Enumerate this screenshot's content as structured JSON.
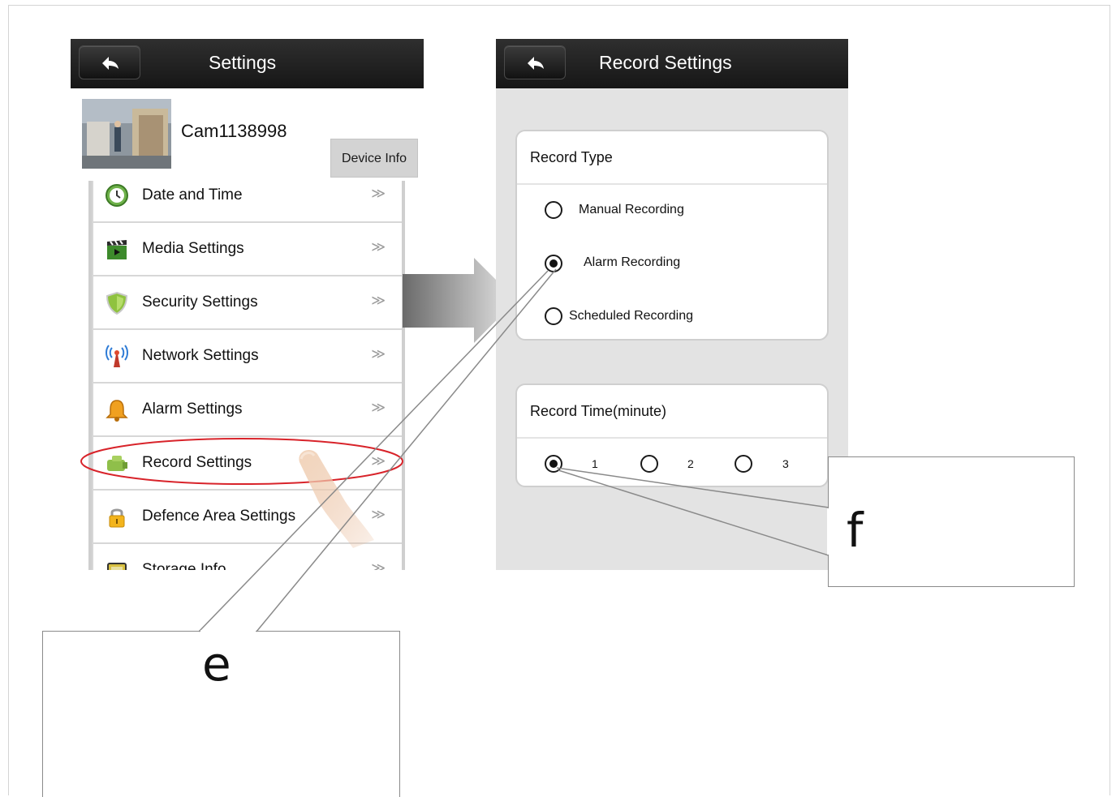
{
  "left_screen": {
    "title": "Settings",
    "device_name": "Cam1138998",
    "device_info_label": "Device Info",
    "menu_items": [
      {
        "label": "Date and Time",
        "icon": "clock-icon",
        "arrow": "≫"
      },
      {
        "label": "Media Settings",
        "icon": "clapperboard-icon",
        "arrow": "≫"
      },
      {
        "label": "Security Settings",
        "icon": "shield-icon",
        "arrow": "≫"
      },
      {
        "label": "Network Settings",
        "icon": "antenna-icon",
        "arrow": "≫"
      },
      {
        "label": "Alarm Settings",
        "icon": "bell-icon",
        "arrow": "≫"
      },
      {
        "label": "Record Settings",
        "icon": "camera-icon",
        "arrow": "≫"
      },
      {
        "label": "Defence Area Settings",
        "icon": "lock-icon",
        "arrow": "≫"
      },
      {
        "label": "Storage Info",
        "icon": "storage-icon",
        "arrow": "≫"
      }
    ],
    "highlighted_item": "Record Settings"
  },
  "right_screen": {
    "title": "Record Settings",
    "record_type": {
      "header": "Record Type",
      "options": [
        {
          "label": "Manual Recording",
          "checked": false
        },
        {
          "label": "Alarm Recording",
          "checked": true
        },
        {
          "label": "Scheduled Recording",
          "checked": false
        }
      ]
    },
    "record_time": {
      "header": "Record Time(minute)",
      "options": [
        {
          "label": "1",
          "checked": true
        },
        {
          "label": "2",
          "checked": false
        },
        {
          "label": "3",
          "checked": false
        }
      ]
    }
  },
  "callouts": {
    "e": "e",
    "f": "f"
  },
  "colors": {
    "topbar": "#1c1c1c",
    "highlight_ellipse": "#d8232a",
    "right_background": "#e3e3e3"
  }
}
